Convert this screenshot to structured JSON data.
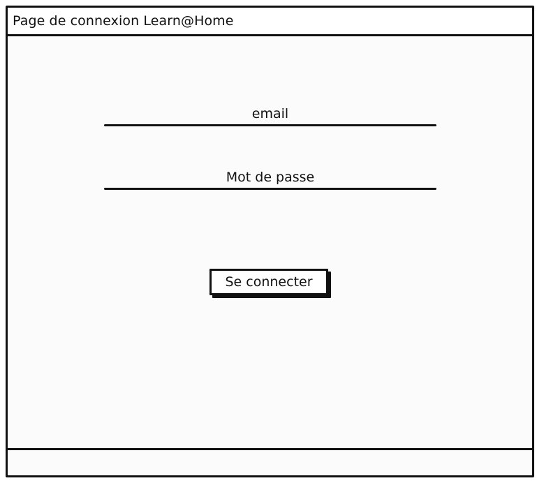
{
  "window": {
    "title": "Page de connexion Learn@Home"
  },
  "form": {
    "email_placeholder": "email",
    "password_placeholder": "Mot de passe",
    "submit_label": "Se connecter"
  }
}
